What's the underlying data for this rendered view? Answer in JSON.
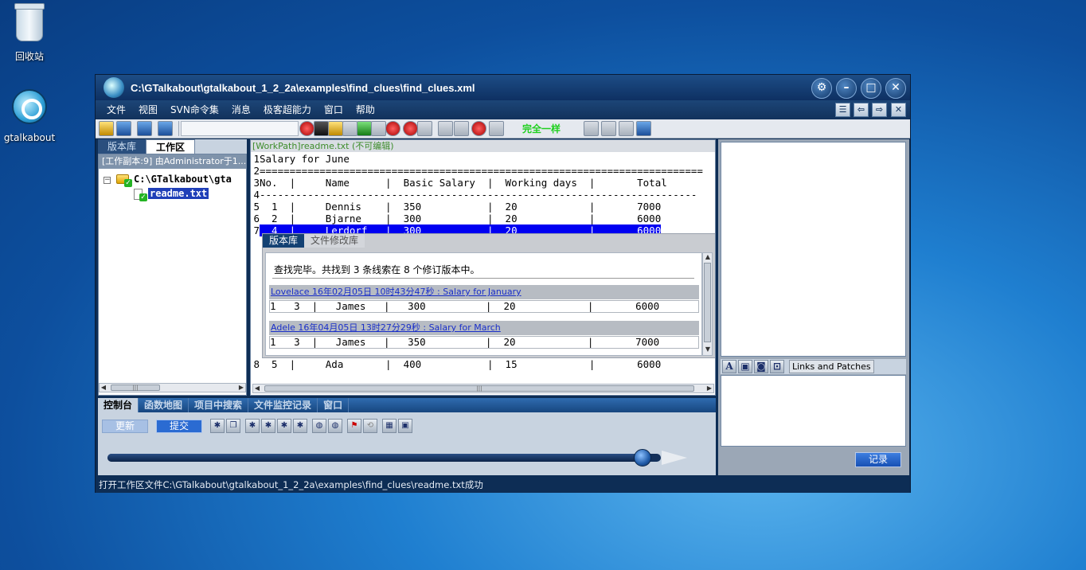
{
  "desktop": {
    "icons": [
      {
        "label": "回收站"
      },
      {
        "label": "gtalkabout"
      }
    ]
  },
  "window": {
    "title": "C:\\GTalkabout\\gtalkabout_1_2_2a\\examples\\find_clues\\find_clues.xml",
    "controls": {
      "settings": "⚙",
      "minimize": "–",
      "maximize": "□",
      "close": "✕"
    }
  },
  "menu": {
    "items": [
      "文件",
      "视图",
      "SVN命令集",
      "消息",
      "极客超能力",
      "窗口",
      "帮助"
    ],
    "mdi": {
      "tile": "☰",
      "back": "⇦",
      "forward": "⇨",
      "close": "✕"
    }
  },
  "toolbar": {
    "status_text": "完全一样"
  },
  "left_pane": {
    "tabs": [
      "版本库",
      "工作区"
    ],
    "active_tab": "工作区",
    "header": "[工作副本:9] 由Administrator于1...",
    "tree": {
      "root_label": "C:\\GTalkabout\\gta",
      "expander": "−",
      "file_label": "readme.txt"
    }
  },
  "editor": {
    "header": "[WorkPath]readme.txt (不可编辑)",
    "lines": [
      {
        "no": "1",
        "text": "Salary for June"
      },
      {
        "no": "2",
        "text": "=========================================================================="
      },
      {
        "no": "3",
        "text": "No.  |     Name      |  Basic Salary  |  Working days  |       Total"
      },
      {
        "no": "4",
        "text": "-------------------------------------------------------------------------"
      },
      {
        "no": "5",
        "text": "  1  |     Dennis    |  350           |  20            |       7000"
      },
      {
        "no": "6",
        "text": "  2  |     Bjarne    |  300           |  20            |       6000"
      },
      {
        "no": "7",
        "text": "  4  |     Lerdorf   |  300           |  20            |       6000"
      },
      {
        "no": "8",
        "text": "  5  |     Ada       |  400           |  15            |       6000"
      }
    ],
    "clue_panel": {
      "tabs": [
        "版本库",
        "文件修改库"
      ],
      "summary": "查找完毕。共找到 3 条线索在 8 个修订版本中。",
      "revisions": [
        {
          "head": "Lovelace 16年02月05日 10时43分47秒 : Salary for January",
          "row": "1   3  |   James   |   300          |  20            |       6000"
        },
        {
          "head": "Adele 16年04月05日 13时27分29秒 : Salary for March",
          "row": "1   3  |   James   |   350          |  20            |       7000"
        }
      ]
    }
  },
  "right_pane": {
    "toolbar_label": "Links and Patches",
    "toolbar_glyph": "A",
    "record_button": "记录"
  },
  "console": {
    "tabs": [
      "控制台",
      "函数地图",
      "项目中搜索",
      "文件监控记录",
      "窗口"
    ],
    "update_button": "更新",
    "commit_button": "提交",
    "progress": 0.98
  },
  "statusbar": {
    "text": "打开工作区文件C:\\GTalkabout\\gtalkabout_1_2_2a\\examples\\find_clues\\readme.txt成功"
  }
}
